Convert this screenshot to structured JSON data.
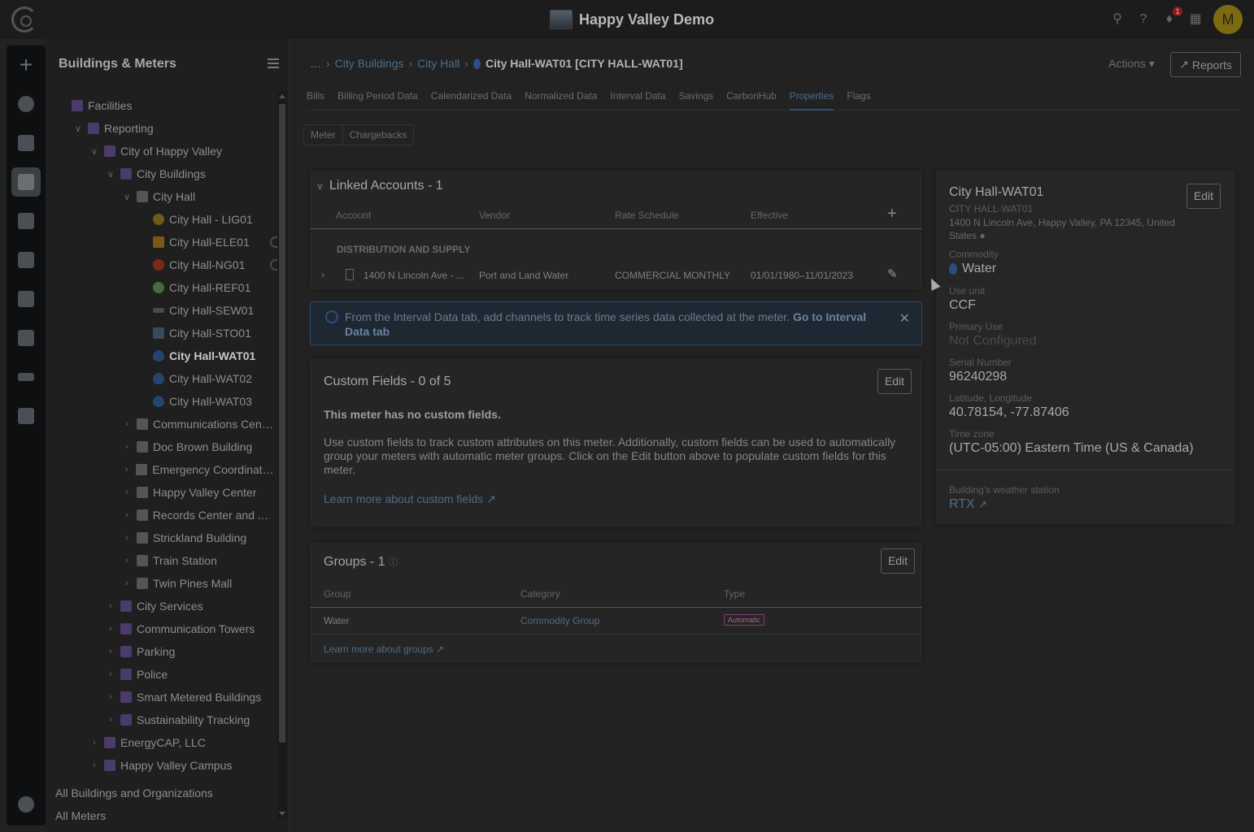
{
  "app": {
    "title": "Happy Valley Demo",
    "avatar_initial": "M",
    "notifications": "1"
  },
  "tree": {
    "title": "Buildings & Meters",
    "items": [
      {
        "label": "Facilities",
        "indent": 0,
        "icon": "org",
        "chev": ""
      },
      {
        "label": "Reporting",
        "indent": 1,
        "icon": "org",
        "chev": "v"
      },
      {
        "label": "City of Happy Valley",
        "indent": 2,
        "icon": "org",
        "chev": "v"
      },
      {
        "label": "City Buildings",
        "indent": 3,
        "icon": "org",
        "chev": "v"
      },
      {
        "label": "City Hall",
        "indent": 4,
        "icon": "bldg",
        "chev": "v"
      },
      {
        "label": "City Hall - LIG01",
        "indent": 5,
        "icon": "light",
        "chev": ""
      },
      {
        "label": "City Hall-ELE01",
        "indent": 5,
        "icon": "elec",
        "chev": "",
        "carbonhub": true
      },
      {
        "label": "City Hall-NG01",
        "indent": 5,
        "icon": "gas",
        "chev": "",
        "carbonhub": true
      },
      {
        "label": "City Hall-REF01",
        "indent": 5,
        "icon": "ref",
        "chev": ""
      },
      {
        "label": "City Hall-SEW01",
        "indent": 5,
        "icon": "sew",
        "chev": ""
      },
      {
        "label": "City Hall-STO01",
        "indent": 5,
        "icon": "sto",
        "chev": ""
      },
      {
        "label": "City Hall-WAT01",
        "indent": 5,
        "icon": "wat",
        "chev": "",
        "selected": true
      },
      {
        "label": "City Hall-WAT02",
        "indent": 5,
        "icon": "wat",
        "chev": ""
      },
      {
        "label": "City Hall-WAT03",
        "indent": 5,
        "icon": "wat",
        "chev": ""
      },
      {
        "label": "Communications Center",
        "indent": 4,
        "icon": "bldg",
        "chev": ">"
      },
      {
        "label": "Doc Brown Building",
        "indent": 4,
        "icon": "bldg",
        "chev": ">"
      },
      {
        "label": "Emergency Coordinatio...",
        "indent": 4,
        "icon": "bldg",
        "chev": ">"
      },
      {
        "label": "Happy Valley Center",
        "indent": 4,
        "icon": "bldg",
        "chev": ">"
      },
      {
        "label": "Records Center and Ar...",
        "indent": 4,
        "icon": "bldg",
        "chev": ">"
      },
      {
        "label": "Strickland Building",
        "indent": 4,
        "icon": "bldg",
        "chev": ">"
      },
      {
        "label": "Train Station",
        "indent": 4,
        "icon": "bldg",
        "chev": ">"
      },
      {
        "label": "Twin Pines Mall",
        "indent": 4,
        "icon": "bldg",
        "chev": ">"
      },
      {
        "label": "City Services",
        "indent": 3,
        "icon": "org",
        "chev": ">"
      },
      {
        "label": "Communication Towers",
        "indent": 3,
        "icon": "org",
        "chev": ">"
      },
      {
        "label": "Parking",
        "indent": 3,
        "icon": "org",
        "chev": ">"
      },
      {
        "label": "Police",
        "indent": 3,
        "icon": "org",
        "chev": ">"
      },
      {
        "label": "Smart Metered Buildings",
        "indent": 3,
        "icon": "org",
        "chev": ">"
      },
      {
        "label": "Sustainability Tracking",
        "indent": 3,
        "icon": "org",
        "chev": ">"
      },
      {
        "label": "EnergyCAP, LLC",
        "indent": 2,
        "icon": "org",
        "chev": ">"
      },
      {
        "label": "Happy Valley Campus",
        "indent": 2,
        "icon": "org",
        "chev": ">"
      }
    ],
    "footer_all_buildings": "All Buildings and Organizations",
    "footer_all_meters": "All Meters"
  },
  "breadcrumb": {
    "items": [
      "City Buildings",
      "City Hall"
    ],
    "current": "City Hall-WAT01 [CITY HALL-WAT01]"
  },
  "header": {
    "actions": "Actions",
    "reports": "Reports"
  },
  "tabs": [
    "Bills",
    "Billing Period Data",
    "Calendarized Data",
    "Normalized Data",
    "Interval Data",
    "Savings",
    "CarbonHub",
    "Properties",
    "Flags"
  ],
  "active_tab": "Properties",
  "subtabs": [
    "Meter",
    "Chargebacks"
  ],
  "linked_accounts": {
    "title": "Linked Accounts - 1",
    "columns": [
      "Account",
      "Vendor",
      "Rate Schedule",
      "Effective"
    ],
    "group_label": "DISTRIBUTION AND SUPPLY",
    "row": {
      "account": "1400 N Lincoln Ave - ...",
      "vendor": "Port and Land Water",
      "rate": "COMMERCIAL MONTHLY",
      "effective": "01/01/1980–11/01/2023"
    }
  },
  "info": {
    "text": "From the Interval Data tab, add channels to track time series data collected at the meter.",
    "link": "Go to Interval Data tab"
  },
  "custom_fields": {
    "title": "Custom Fields - 0 of 5",
    "edit": "Edit",
    "empty_heading": "This meter has no custom fields.",
    "body": "Use custom fields to track custom attributes on this meter. Additionally, custom fields can be used to automatically group your meters with automatic meter groups. Click on the Edit button above to populate custom fields for this meter.",
    "learn_more": "Learn more about custom fields"
  },
  "groups": {
    "title": "Groups - 1",
    "edit": "Edit",
    "columns": [
      "Group",
      "Category",
      "Type"
    ],
    "row": {
      "group": "Water",
      "category": "Commodity Group",
      "type": "Automatic"
    },
    "learn_more": "Learn more about groups"
  },
  "meter_info": {
    "name": "City Hall-WAT01",
    "code": "CITY HALL-WAT01",
    "address": "1400 N Lincoln Ave, Happy Valley, PA 12345, United States",
    "edit": "Edit",
    "commodity_label": "Commodity",
    "commodity": "Water",
    "use_unit_label": "Use unit",
    "use_unit": "CCF",
    "primary_use_label": "Primary Use",
    "primary_use": "Not Configured",
    "serial_label": "Serial Number",
    "serial": "96240298",
    "latlong_label": "Latitude, Longitude",
    "latlong": "40.78154, -77.87406",
    "timezone_label": "Time zone",
    "timezone": "(UTC-05:00) Eastern Time (US & Canada)",
    "weather_label": "Building's weather station",
    "weather": "RTX"
  }
}
